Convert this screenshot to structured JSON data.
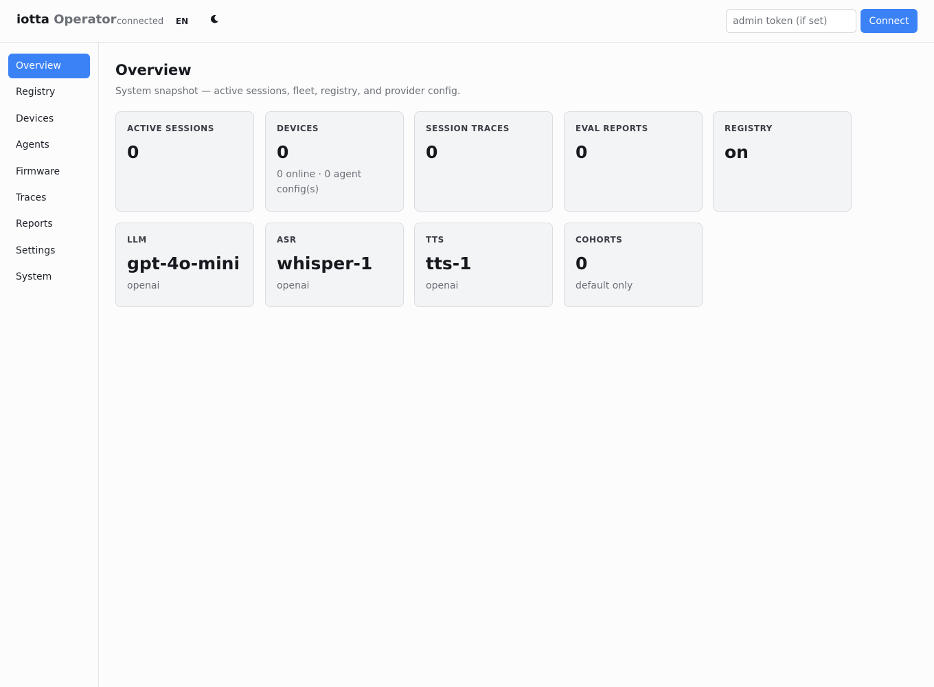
{
  "header": {
    "brand_main": "iotta",
    "brand_sub": "Operator",
    "status": "connected",
    "language": "EN",
    "theme_icon": "moon-icon",
    "token_placeholder": "admin token (if set)",
    "connect_label": "Connect"
  },
  "sidebar": {
    "items": [
      {
        "label": "Overview",
        "active": true
      },
      {
        "label": "Registry"
      },
      {
        "label": "Devices"
      },
      {
        "label": "Agents"
      },
      {
        "label": "Firmware"
      },
      {
        "label": "Traces"
      },
      {
        "label": "Reports"
      },
      {
        "label": "Settings"
      },
      {
        "label": "System"
      }
    ]
  },
  "main": {
    "title": "Overview",
    "subtitle": "System snapshot — active sessions, fleet, registry, and provider config.",
    "cards": [
      {
        "label": "Active Sessions",
        "value": "0"
      },
      {
        "label": "Devices",
        "value": "0",
        "sub": "0 online · 0 agent config(s)"
      },
      {
        "label": "Session Traces",
        "value": "0"
      },
      {
        "label": "Eval Reports",
        "value": "0"
      },
      {
        "label": "Registry",
        "value": "on"
      },
      {
        "label": "LLM",
        "value": "gpt-4o-mini",
        "sub": "openai"
      },
      {
        "label": "ASR",
        "value": "whisper-1",
        "sub": "openai"
      },
      {
        "label": "TTS",
        "value": "tts-1",
        "sub": "openai"
      },
      {
        "label": "Cohorts",
        "value": "0",
        "sub": "default only"
      }
    ]
  },
  "colors": {
    "accent": "#3b82f6",
    "background": "#fcfcfd",
    "card_background": "#f3f4f6",
    "muted_text": "#6b6f76"
  }
}
